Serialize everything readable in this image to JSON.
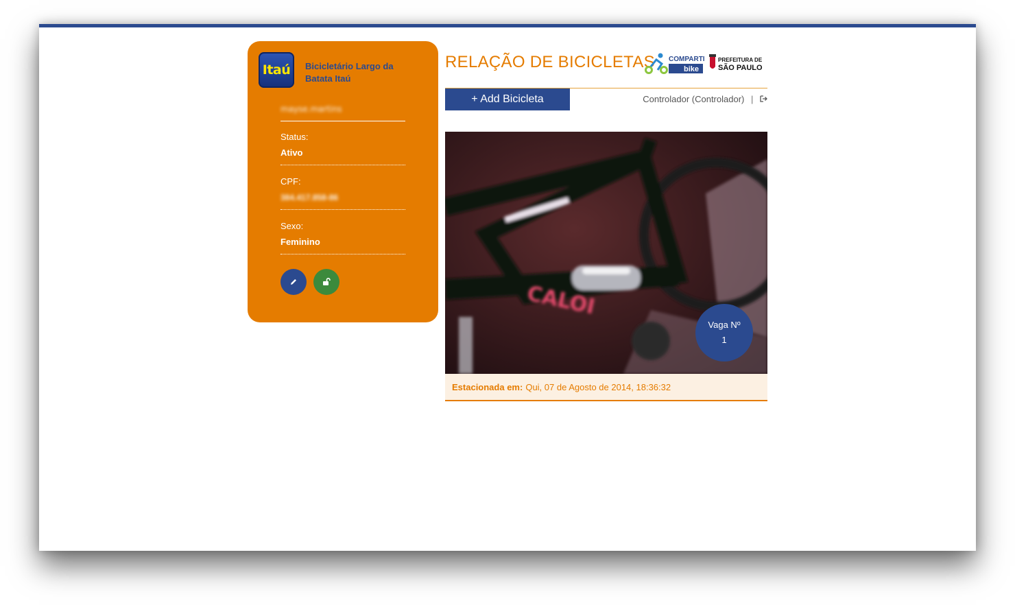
{
  "colors": {
    "brand_blue": "#2b4a8f",
    "brand_orange": "#e57c00",
    "unlock_green": "#3c8a3c",
    "info_bg": "#fcf0e2"
  },
  "sidebar": {
    "logo_text": "Itaú",
    "station_name": "Bicicletário Largo da Batata Itaú",
    "user_name": "mayse.martins",
    "fields": [
      {
        "label": "Status:",
        "value": "Ativo",
        "blurred": false
      },
      {
        "label": "CPF:",
        "value": "384.417.858-86",
        "blurred": true
      },
      {
        "label": "Sexo:",
        "value": "Feminino",
        "blurred": false
      }
    ],
    "edit_icon": "pencil-icon",
    "unlock_icon": "unlock-icon"
  },
  "header": {
    "title": "RELAÇÃO DE BICICLETAS",
    "logo_compartibike_top": "COMPARTI",
    "logo_compartibike_bottom": "bike",
    "logo_prefeitura_top": "PREFEITURA DE",
    "logo_prefeitura_bottom": "SÃO PAULO"
  },
  "toolbar": {
    "add_label": "+ Add Bicicleta",
    "user_label": "Controlador (Controlador)",
    "separator": "|",
    "logout_icon": "logout-icon"
  },
  "bike": {
    "photo_brand_text": "CALOI",
    "vaga_label": "Vaga Nº",
    "vaga_number": "1",
    "parked_label": "Estacionada em:",
    "parked_value": "Qui, 07 de Agosto de 2014, 18:36:32"
  }
}
